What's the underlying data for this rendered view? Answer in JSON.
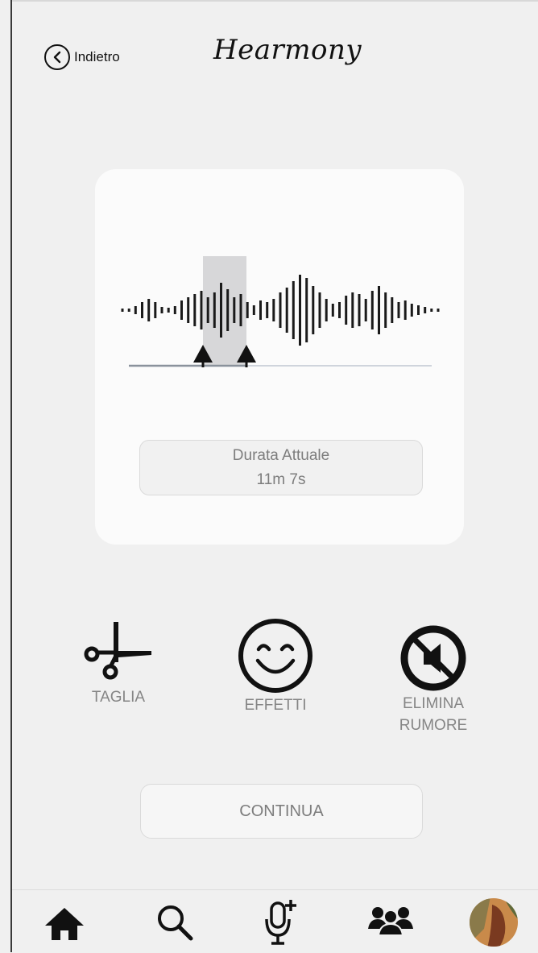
{
  "header": {
    "back_label": "Indietro",
    "brand": "Hearmony"
  },
  "editor": {
    "duration_label": "Durata Attuale",
    "duration_value": "11m 7s"
  },
  "tools": [
    {
      "label": "TAGLIA",
      "icon": "scissors-icon"
    },
    {
      "label": "EFFETTI",
      "icon": "smiley-icon"
    },
    {
      "label_line1": "ELIMINA",
      "label_line2": "RUMORE",
      "icon": "mute-icon"
    }
  ],
  "continue_label": "CONTINUA",
  "nav": [
    {
      "icon": "home-icon"
    },
    {
      "icon": "search-icon"
    },
    {
      "icon": "add-mic-icon"
    },
    {
      "icon": "community-icon"
    },
    {
      "icon": "profile-avatar"
    }
  ],
  "colors": {
    "background": "#f0f0f0",
    "card": "#fbfbfb",
    "muted_text": "#7d7d7d",
    "selection": "#d7d7d9"
  }
}
